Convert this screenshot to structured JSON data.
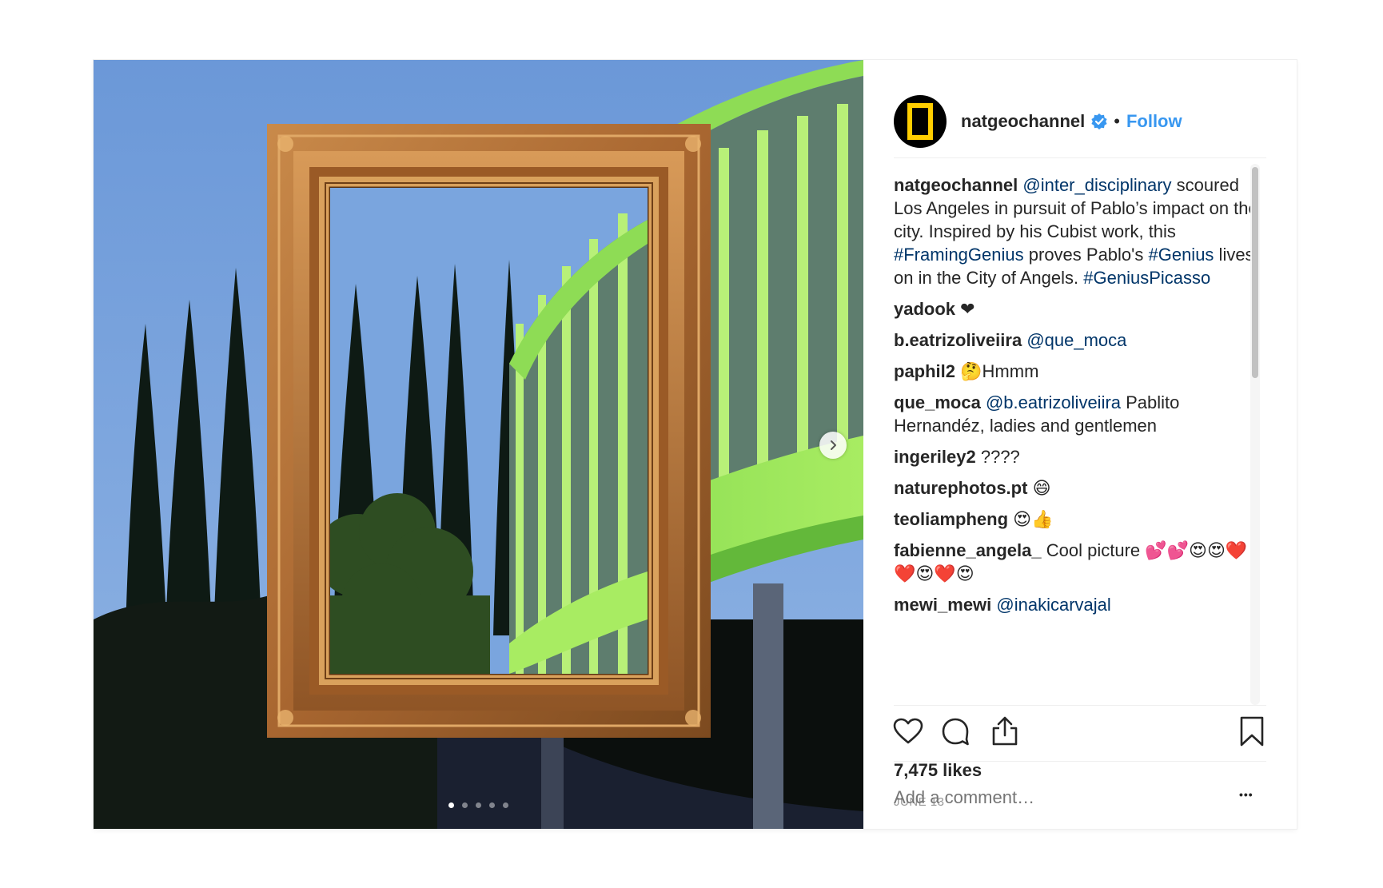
{
  "post": {
    "media": {
      "carousel": {
        "total": 5,
        "active_index": 0
      },
      "next_icon": "chevron-right-icon"
    },
    "header": {
      "avatar_icon": "natgeo-logo",
      "username": "natgeochannel",
      "verified_icon": "verified-badge-icon",
      "separator": "•",
      "follow_label": "Follow"
    },
    "caption": {
      "username": "natgeochannel",
      "segments": [
        {
          "text": "@inter_disciplinary",
          "link": true
        },
        {
          "text": " scoured Los Angeles in pursuit of Pablo’s impact on the city. Inspired by his Cubist work, this ",
          "link": false
        },
        {
          "text": "#FramingGenius",
          "link": true
        },
        {
          "text": " proves Pablo's ",
          "link": false
        },
        {
          "text": "#Genius",
          "link": true
        },
        {
          "text": " lives on in the City of Angels. ",
          "link": false
        },
        {
          "text": "#GeniusPicasso",
          "link": true
        }
      ]
    },
    "comments": [
      {
        "username": "yadook",
        "segments": [
          {
            "text": "❤",
            "link": false
          }
        ]
      },
      {
        "username": "b.eatrizoliveiira",
        "segments": [
          {
            "text": "@que_moca",
            "link": true
          }
        ]
      },
      {
        "username": "paphil2",
        "segments": [
          {
            "text": "🤔Hmmm",
            "link": false
          }
        ]
      },
      {
        "username": "que_moca",
        "segments": [
          {
            "text": "@b.eatrizoliveiira",
            "link": true
          },
          {
            "text": " Pablito Hernandéz, ladies and gentlemen",
            "link": false
          }
        ]
      },
      {
        "username": "ingeriley2",
        "segments": [
          {
            "text": "????",
            "link": false
          }
        ]
      },
      {
        "username": "naturephotos.pt",
        "segments": [
          {
            "text": "😄",
            "link": false
          }
        ]
      },
      {
        "username": "teoliampheng",
        "segments": [
          {
            "text": "😍👍",
            "link": false
          }
        ]
      },
      {
        "username": "fabienne_angela_",
        "segments": [
          {
            "text": "Cool picture 💕💕😍😍❤️❤️😍❤️😍",
            "link": false
          }
        ]
      },
      {
        "username": "mewi_mewi",
        "segments": [
          {
            "text": "@inakicarvajal",
            "link": true
          }
        ]
      }
    ],
    "actions": {
      "like_icon": "heart-icon",
      "comment_icon": "comment-bubble-icon",
      "share_icon": "share-icon",
      "save_icon": "bookmark-icon"
    },
    "likes_text": "7,475 likes",
    "date_text": "JUNE 13",
    "add_comment": {
      "placeholder": "Add a comment…",
      "more_icon": "more-options-icon",
      "more_label": "•••"
    },
    "colors": {
      "link": "#003569",
      "follow": "#3897f0",
      "verified": "#3897f0",
      "text": "#262626",
      "muted": "#999999"
    }
  }
}
